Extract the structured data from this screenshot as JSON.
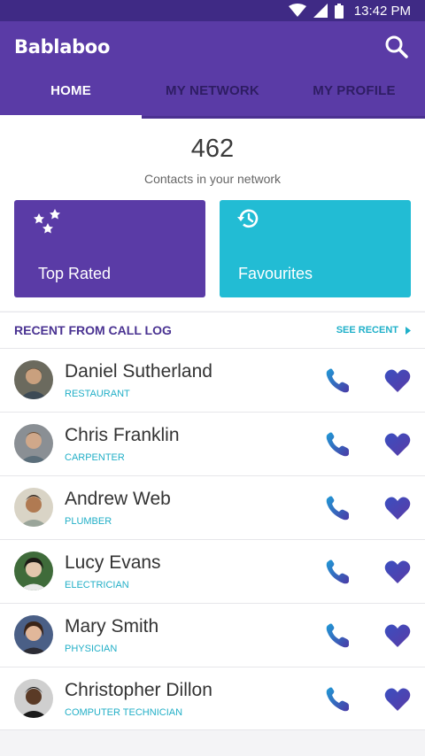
{
  "status_bar": {
    "time": "13:42 PM"
  },
  "app": {
    "title": "Bablaboo"
  },
  "tabs": [
    {
      "label": "HOME",
      "active": true
    },
    {
      "label": "MY NETWORK",
      "active": false
    },
    {
      "label": "MY PROFILE",
      "active": false
    }
  ],
  "stats": {
    "count": "462",
    "label": "Contacts in your network"
  },
  "cards": {
    "top_rated": {
      "label": "Top Rated",
      "icon": "stars-icon",
      "color": "#5a3ba6"
    },
    "favourites": {
      "label": "Favourites",
      "icon": "history-icon",
      "color": "#22bcd4"
    }
  },
  "section": {
    "title": "RECENT FROM CALL LOG",
    "action": "SEE RECENT"
  },
  "contacts": [
    {
      "name": "Daniel Sutherland",
      "role": "RESTAURANT"
    },
    {
      "name": "Chris Franklin",
      "role": "CARPENTER"
    },
    {
      "name": "Andrew Web",
      "role": "PLUMBER"
    },
    {
      "name": "Lucy Evans",
      "role": "ELECTRICIAN"
    },
    {
      "name": "Mary Smith",
      "role": "PHYSICIAN"
    },
    {
      "name": "Christopher Dillon",
      "role": "COMPUTER TECHNICIAN"
    }
  ],
  "colors": {
    "primary": "#5a3ba6",
    "accent": "#22bcd4",
    "status_bar": "#3f2a85"
  }
}
